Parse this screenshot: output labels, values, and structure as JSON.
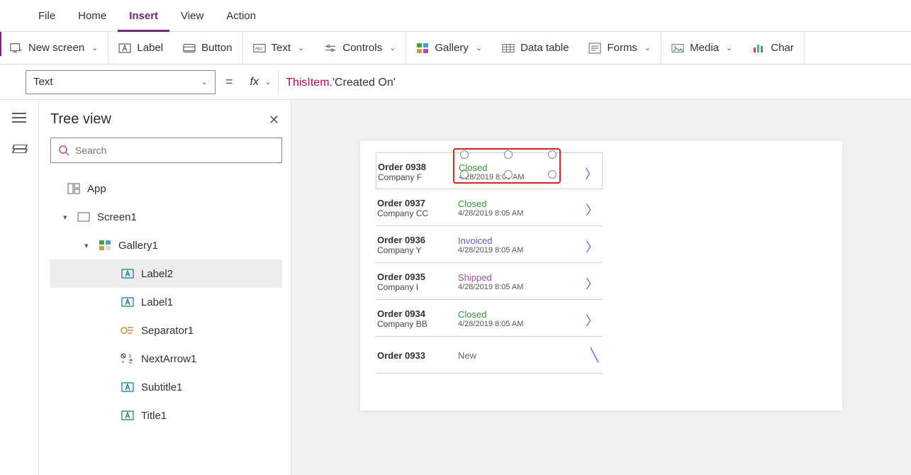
{
  "menu": {
    "file": "File",
    "home": "Home",
    "insert": "Insert",
    "view": "View",
    "action": "Action"
  },
  "ribbon": {
    "newScreen": "New screen",
    "label": "Label",
    "button": "Button",
    "text": "Text",
    "controls": "Controls",
    "gallery": "Gallery",
    "dataTable": "Data table",
    "forms": "Forms",
    "media": "Media",
    "chart": "Char"
  },
  "formula": {
    "property": "Text",
    "fx": "fx",
    "this": "ThisItem",
    "rest": ".'Created On'"
  },
  "tree": {
    "title": "Tree view",
    "searchPlaceholder": "Search",
    "app": "App",
    "screen": "Screen1",
    "gallery": "Gallery1",
    "items": [
      "Label2",
      "Label1",
      "Separator1",
      "NextArrow1",
      "Subtitle1",
      "Title1"
    ]
  },
  "orders": [
    {
      "id": "Order 0938",
      "company": "Company F",
      "status": "Closed",
      "statusClass": "s-closed",
      "date": "4/28/2019 8:05 AM"
    },
    {
      "id": "Order 0937",
      "company": "Company CC",
      "status": "Closed",
      "statusClass": "s-closed",
      "date": "4/28/2019 8:05 AM"
    },
    {
      "id": "Order 0936",
      "company": "Company Y",
      "status": "Invoiced",
      "statusClass": "s-invoiced",
      "date": "4/28/2019 8:05 AM"
    },
    {
      "id": "Order 0935",
      "company": "Company I",
      "status": "Shipped",
      "statusClass": "s-shipped",
      "date": "4/28/2019 8:05 AM"
    },
    {
      "id": "Order 0934",
      "company": "Company BB",
      "status": "Closed",
      "statusClass": "s-closed",
      "date": "4/28/2019 8:05 AM"
    },
    {
      "id": "Order 0933",
      "company": "",
      "status": "New",
      "statusClass": "s-new",
      "date": ""
    }
  ]
}
